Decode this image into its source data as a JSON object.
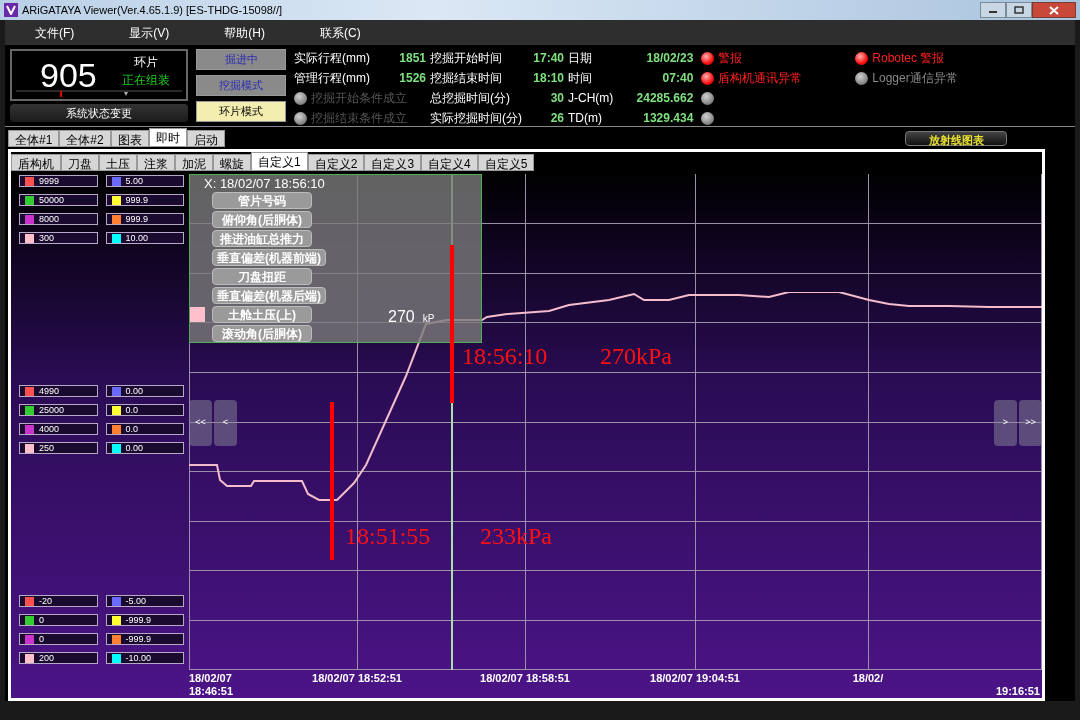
{
  "window": {
    "title": "ARiGATAYA Viewer(Ver.4.65.1.9) [ES-THDG-15098//]"
  },
  "menu": [
    "文件(F)",
    "显示(V)",
    "帮助(H)",
    "联系(C)"
  ],
  "counter": {
    "value": "905",
    "unit": "环片",
    "state": "正在组装",
    "button": "系统状态变更"
  },
  "modes": [
    {
      "label": "掘进中",
      "selected": false
    },
    {
      "label": "挖掘模式",
      "selected": false
    },
    {
      "label": "环片模式",
      "selected": true
    }
  ],
  "status_rows": [
    {
      "cells": [
        {
          "kind": "reading",
          "label": "实际行程(mm)",
          "value": "1851"
        },
        {
          "kind": "reading",
          "label": "挖掘开始时间",
          "value": "17:40"
        },
        {
          "kind": "reading",
          "label": "日期",
          "value": "18/02/23"
        }
      ],
      "alarm": {
        "on": true,
        "text": "警报"
      },
      "alarm2": {
        "on": true,
        "text": "Robotec 警报"
      }
    },
    {
      "cells": [
        {
          "kind": "reading",
          "label": "管理行程(mm)",
          "value": "1526"
        },
        {
          "kind": "reading",
          "label": "挖掘结束时间",
          "value": "18:10"
        },
        {
          "kind": "reading",
          "label": "时间",
          "value": "07:40"
        }
      ],
      "alarm": {
        "on": true,
        "text": "盾构机通讯异常"
      },
      "alarm2": {
        "on": false,
        "text": "Logger通信异常"
      }
    },
    {
      "cells": [
        {
          "kind": "condition",
          "label": "挖掘开始条件成立",
          "on": false
        },
        {
          "kind": "reading",
          "label": "总挖掘时间(分)",
          "value": "30"
        },
        {
          "kind": "reading",
          "label": "J-CH(m)",
          "value": "24285.662"
        }
      ],
      "alarm": {
        "on": false
      }
    },
    {
      "cells": [
        {
          "kind": "condition",
          "label": "挖掘结束条件成立",
          "on": false
        },
        {
          "kind": "reading",
          "label": "实际挖掘时间(分)",
          "value": "26"
        },
        {
          "kind": "reading",
          "label": "TD(m)",
          "value": "1329.434"
        }
      ],
      "alarm": {
        "on": false
      }
    }
  ],
  "main_tabs": [
    {
      "label": "全体#1",
      "selected": false
    },
    {
      "label": "全体#2",
      "selected": false
    },
    {
      "label": "图表",
      "selected": false
    },
    {
      "label": "即时",
      "selected": true
    },
    {
      "label": "启动",
      "selected": false
    }
  ],
  "radial_button": "放射线图表",
  "sub_tabs": [
    {
      "label": "盾构机",
      "selected": false
    },
    {
      "label": "刀盘",
      "selected": false
    },
    {
      "label": "土压",
      "selected": false
    },
    {
      "label": "注浆",
      "selected": false
    },
    {
      "label": "加泥",
      "selected": false
    },
    {
      "label": "螺旋",
      "selected": false
    },
    {
      "label": "自定义1",
      "selected": true
    },
    {
      "label": "自定义2",
      "selected": false
    },
    {
      "label": "自定义3",
      "selected": false
    },
    {
      "label": "自定义4",
      "selected": false
    },
    {
      "label": "自定义5",
      "selected": false
    }
  ],
  "legend_groups": [
    {
      "entries": [
        {
          "color": "#ff5050",
          "value": "9999"
        },
        {
          "color": "#6a6aff",
          "value": "5.00"
        },
        {
          "color": "#33cc33",
          "value": "50000"
        },
        {
          "color": "#ffff33",
          "value": "999.9"
        },
        {
          "color": "#cc33cc",
          "value": "8000"
        },
        {
          "color": "#ff8033",
          "value": "999.9"
        },
        {
          "color": "#ffc0cb",
          "value": "300"
        },
        {
          "color": "#00ffff",
          "value": "10.00"
        }
      ]
    },
    {
      "entries": [
        {
          "color": "#ff5050",
          "value": "4990"
        },
        {
          "color": "#6a6aff",
          "value": "0.00"
        },
        {
          "color": "#33cc33",
          "value": "25000"
        },
        {
          "color": "#ffff33",
          "value": "0.0"
        },
        {
          "color": "#cc33cc",
          "value": "4000"
        },
        {
          "color": "#ff8033",
          "value": "0.0"
        },
        {
          "color": "#ffc0cb",
          "value": "250"
        },
        {
          "color": "#00ffff",
          "value": "0.00"
        }
      ]
    },
    {
      "entries": [
        {
          "color": "#ff5050",
          "value": "-20"
        },
        {
          "color": "#6a6aff",
          "value": "-5.00"
        },
        {
          "color": "#33cc33",
          "value": "0"
        },
        {
          "color": "#ffff33",
          "value": "-999.9"
        },
        {
          "color": "#cc33cc",
          "value": "0"
        },
        {
          "color": "#ff8033",
          "value": "-999.9"
        },
        {
          "color": "#ffc0cb",
          "value": "200"
        },
        {
          "color": "#00ffff",
          "value": "-10.00"
        }
      ]
    }
  ],
  "tooltip": {
    "title": "X: 18/02/07 18:56:10",
    "items": [
      {
        "label": "管片号码",
        "selected": false
      },
      {
        "label": "俯仰角(后胴体)",
        "selected": false
      },
      {
        "label": "推进油缸总推力",
        "selected": false
      },
      {
        "label": "垂直偏差(机器前端)",
        "selected": false
      },
      {
        "label": "刀盘扭距",
        "selected": false
      },
      {
        "label": "垂直偏差(机器后端)",
        "selected": false
      },
      {
        "label": "土舱土压(上)",
        "selected": true
      },
      {
        "label": "滚动角(后胴体)",
        "selected": false
      }
    ],
    "value": "270",
    "unit": "kP"
  },
  "nav_buttons": {
    "left": [
      "<<",
      "<"
    ],
    "right": [
      ">",
      ">>"
    ]
  },
  "x_labels": [
    {
      "lines": [
        "18/02/07",
        "18:46:51"
      ],
      "kind": "start"
    },
    {
      "lines": [
        "18/02/07 18:52:51"
      ],
      "kind": "tick"
    },
    {
      "lines": [
        "18/02/07 18:58:51"
      ],
      "kind": "tick"
    },
    {
      "lines": [
        "18/02/07 19:04:51"
      ],
      "kind": "tick"
    },
    {
      "lines": [
        "18/02/"
      ],
      "kind": "tick"
    },
    {
      "lines": [
        "19:16:51"
      ],
      "kind": "end"
    }
  ],
  "annotations": [
    {
      "time": "18:51:55",
      "reading": "233kPa",
      "kind": "low"
    },
    {
      "time": "18:56:10",
      "reading": "270kPa",
      "kind": "high"
    }
  ]
}
